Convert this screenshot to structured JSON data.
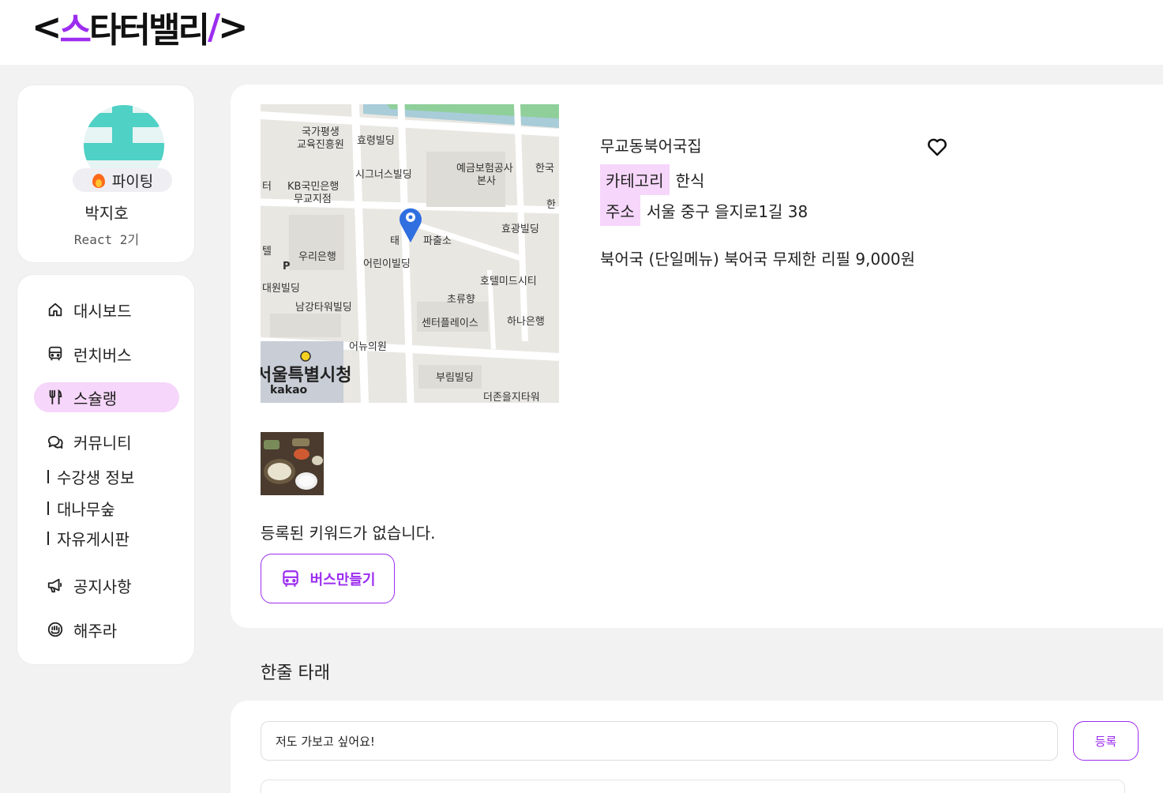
{
  "header": {
    "logo": {
      "open": "<",
      "accent_1": "스",
      "text": "타터밸리",
      "accent_2": "/",
      "close": ">"
    }
  },
  "profile": {
    "badge": "파이팅",
    "badge_icon": "fire-icon",
    "name": "박지호",
    "class": "React 2기"
  },
  "nav": {
    "items": [
      {
        "label": "대시보드",
        "icon": "home-icon"
      },
      {
        "label": "런치버스",
        "icon": "bus-icon"
      },
      {
        "label": "스슐랭",
        "icon": "utensils-icon",
        "active": true
      },
      {
        "label": "커뮤니티",
        "icon": "chat-icon"
      },
      {
        "label": "공지사항",
        "icon": "megaphone-icon"
      },
      {
        "label": "해주라",
        "icon": "hand-icon"
      }
    ],
    "community_sub": [
      "수강생 정보",
      "대나무숲",
      "자유게시판"
    ]
  },
  "place": {
    "name": "무교동북어국집",
    "category_label": "카테고리",
    "category": "한식",
    "address_label": "주소",
    "address": "서울 중구 을지로1길 38",
    "menu": "북어국 (단일메뉴) 북어국 무제한 리필 9,000원",
    "no_keyword": "등록된 키워드가 없습니다.",
    "bus_button": "버스만들기"
  },
  "map": {
    "labels": [
      "국가평생",
      "교육진흥원",
      "효령빌딩",
      "시그너스빌딩",
      "예금보험공사",
      "본사",
      "한국",
      "한",
      "KB국민은행",
      "무교지점",
      "터",
      "텔",
      "우리은행",
      "어린이빌딩",
      "태",
      "파출소",
      "효광빌딩",
      "호텔미드시티",
      "초류향",
      "대원빌딩",
      "남강타워빌딩",
      "센터플레이스",
      "하나은행",
      "어뉴의원",
      "서울특별시청",
      "부림빌딩",
      "더존을지타워",
      "P"
    ],
    "brand": "kakao"
  },
  "comments": {
    "title": "한줄 타래",
    "input_value": "저도 가보고 싶어요!",
    "submit": "등록"
  }
}
